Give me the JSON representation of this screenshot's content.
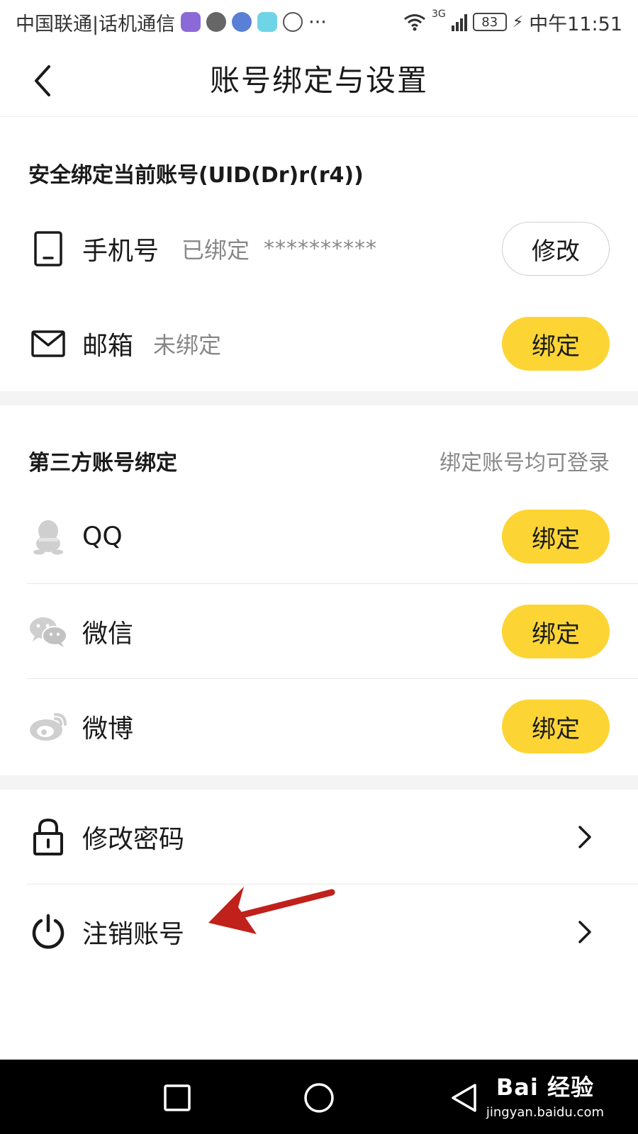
{
  "status_bar": {
    "carrier": "中国联通|话机通信",
    "more": "···",
    "network": "3G",
    "battery": "83",
    "time": "中午11:51"
  },
  "header": {
    "title": "账号绑定与设置"
  },
  "security": {
    "title": "安全绑定当前账号(UID(Dr)r(r4))",
    "phone": {
      "label": "手机号",
      "status": "已绑定",
      "masked": "**********",
      "action": "修改"
    },
    "email": {
      "label": "邮箱",
      "status": "未绑定",
      "action": "绑定"
    }
  },
  "third_party": {
    "title": "第三方账号绑定",
    "note": "绑定账号均可登录",
    "items": [
      {
        "label": "QQ",
        "action": "绑定"
      },
      {
        "label": "微信",
        "action": "绑定"
      },
      {
        "label": "微博",
        "action": "绑定"
      }
    ]
  },
  "account": {
    "items": [
      {
        "label": "修改密码"
      },
      {
        "label": "注销账号"
      }
    ]
  },
  "watermark": {
    "main": "Bai 经验",
    "sub": "jingyan.baidu.com"
  },
  "colors": {
    "accent_yellow": "#fcd535",
    "annotation_red": "#c0211a",
    "gap_gray": "#f4f4f4",
    "muted_text": "#888888"
  },
  "icons": {
    "back": "chevron-left-icon",
    "phone": "phone-icon",
    "email": "envelope-icon",
    "qq": "qq-penguin-icon",
    "wechat": "wechat-icon",
    "weibo": "weibo-icon",
    "password": "lock-icon",
    "deregister": "power-icon"
  }
}
